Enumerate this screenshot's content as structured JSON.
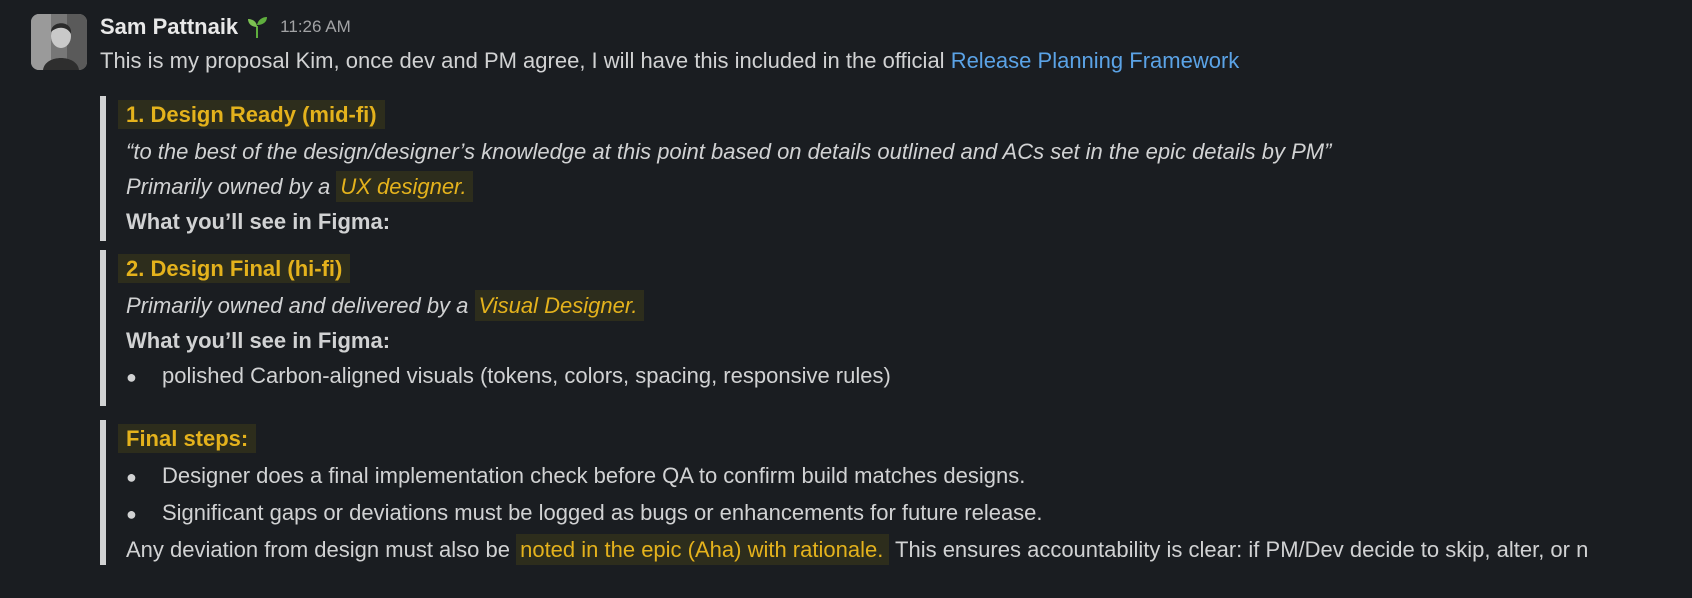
{
  "message": {
    "sender": "Sam Pattnaik",
    "timestamp": "11:26 AM",
    "status_icon": "seedling-icon",
    "intro_text": "This is my proposal Kim, once dev and PM agree, I will have this included in the official ",
    "intro_link": "Release Planning Framework"
  },
  "section1": {
    "heading": "1. Design Ready (mid-fi)",
    "quote_text": "“to the best of the design/designer’s knowledge at this point based on details outlined and ACs set in the epic details by PM”",
    "owner_prefix": "Primarily owned by a ",
    "owner_highlight": "UX designer.",
    "figma_label": "What you’ll see in Figma:"
  },
  "section2": {
    "heading": "2. Design Final (hi-fi)",
    "owner_prefix": "Primarily owned and delivered by a ",
    "owner_highlight": "Visual Designer.",
    "figma_label": "What you’ll see in Figma:",
    "bullets": [
      "polished Carbon-aligned visuals (tokens, colors, spacing, responsive rules)"
    ]
  },
  "section3": {
    "heading": "Final steps:",
    "bullets": [
      "Designer does a final implementation check before QA to confirm build matches designs.",
      "Significant gaps or deviations must be logged as bugs or enhancements for future release."
    ],
    "closing_prefix": "Any deviation from design must also be ",
    "closing_highlight": "noted in the epic (Aha) with rationale.",
    "closing_suffix": " This ensures accountability is clear: if PM/Dev decide to skip, alter, or n"
  },
  "colors": {
    "background": "#1a1d21",
    "text": "#d1d2d3",
    "link": "#5ba3e6",
    "highlight_text": "#e4b21c",
    "highlight_bg": "#2d2d1c"
  }
}
